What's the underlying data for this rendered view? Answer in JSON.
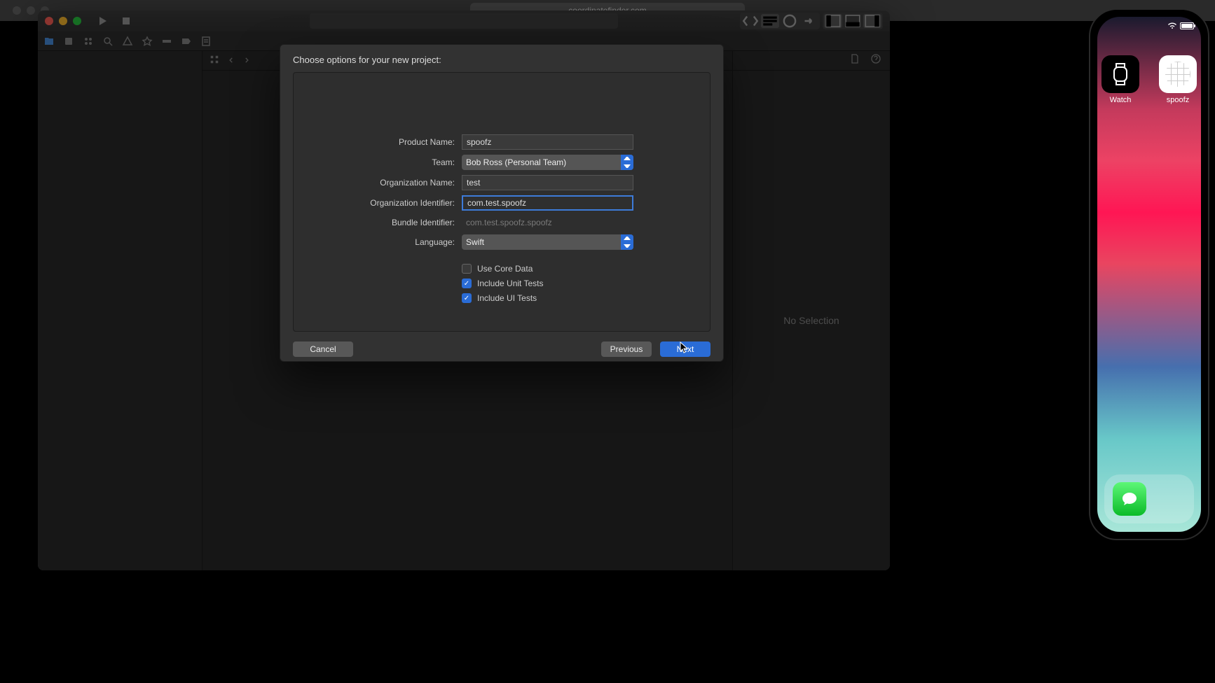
{
  "browser": {
    "url": "coordinatefinder.com"
  },
  "xcode": {
    "toolbar": {
      "search_placeholder": ""
    },
    "inspector": {
      "empty": "No Selection"
    }
  },
  "sheet": {
    "title": "Choose options for your new project:",
    "labels": {
      "product_name": "Product Name:",
      "team": "Team:",
      "org_name": "Organization Name:",
      "org_id": "Organization Identifier:",
      "bundle_id": "Bundle Identifier:",
      "language": "Language:"
    },
    "values": {
      "product_name": "spoofz",
      "team": "Bob Ross (Personal Team)",
      "org_name": "test",
      "org_id": "com.test.spoofz",
      "bundle_id": "com.test.spoofz.spoofz",
      "language": "Swift"
    },
    "checks": {
      "core_data": "Use Core Data",
      "unit_tests": "Include Unit Tests",
      "ui_tests": "Include UI Tests"
    },
    "buttons": {
      "cancel": "Cancel",
      "previous": "Previous",
      "next": "Next"
    }
  },
  "simulator": {
    "apps": {
      "watch": "Watch",
      "spoofz": "spoofz"
    }
  }
}
